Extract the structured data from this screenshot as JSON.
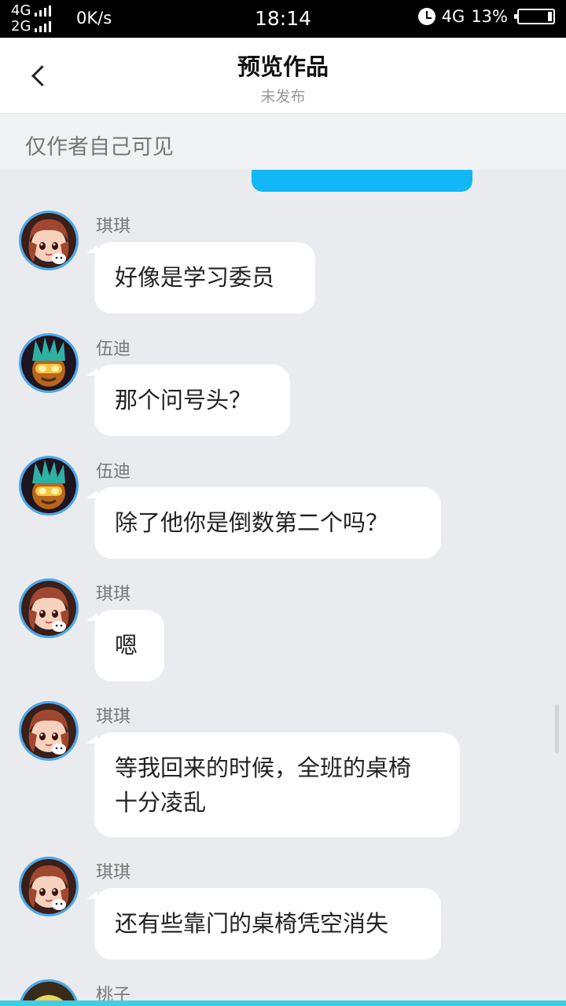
{
  "status_bar": {
    "net_top": "4G",
    "net_bottom": "2G",
    "speed": "0K/s",
    "time": "18:14",
    "net_right": "4G",
    "battery": "13%",
    "battery_level": 0.13,
    "icons": [
      "signal-icon",
      "alarm-icon",
      "battery-icon"
    ]
  },
  "header": {
    "title": "预览作品",
    "subtitle": "未发布",
    "back_icon": "chevron-left-icon"
  },
  "notice": "仅作者自己可见",
  "colors": {
    "accent_bubble": "#12b7f5",
    "avatar_ring": "#4aa9ee",
    "background": "#eaebef",
    "bottom_bar": "#3fcfe4"
  },
  "messages": [
    {
      "sender": "琪琪",
      "text": "好像是学习委员",
      "avatar": "qiqi-avatar"
    },
    {
      "sender": "伍迪",
      "text": "那个问号头？",
      "avatar": "wudi-avatar"
    },
    {
      "sender": "伍迪",
      "text": "除了他你是倒数第二个吗？",
      "avatar": "wudi-avatar"
    },
    {
      "sender": "琪琪",
      "text": "嗯",
      "avatar": "qiqi-avatar"
    },
    {
      "sender": "琪琪",
      "text": "等我回来的时候，全班的桌椅十分凌乱",
      "avatar": "qiqi-avatar"
    },
    {
      "sender": "琪琪",
      "text": "还有些靠门的桌椅凭空消失",
      "avatar": "qiqi-avatar"
    },
    {
      "sender": "桃子",
      "text": "",
      "avatar": "taozi-avatar"
    }
  ]
}
